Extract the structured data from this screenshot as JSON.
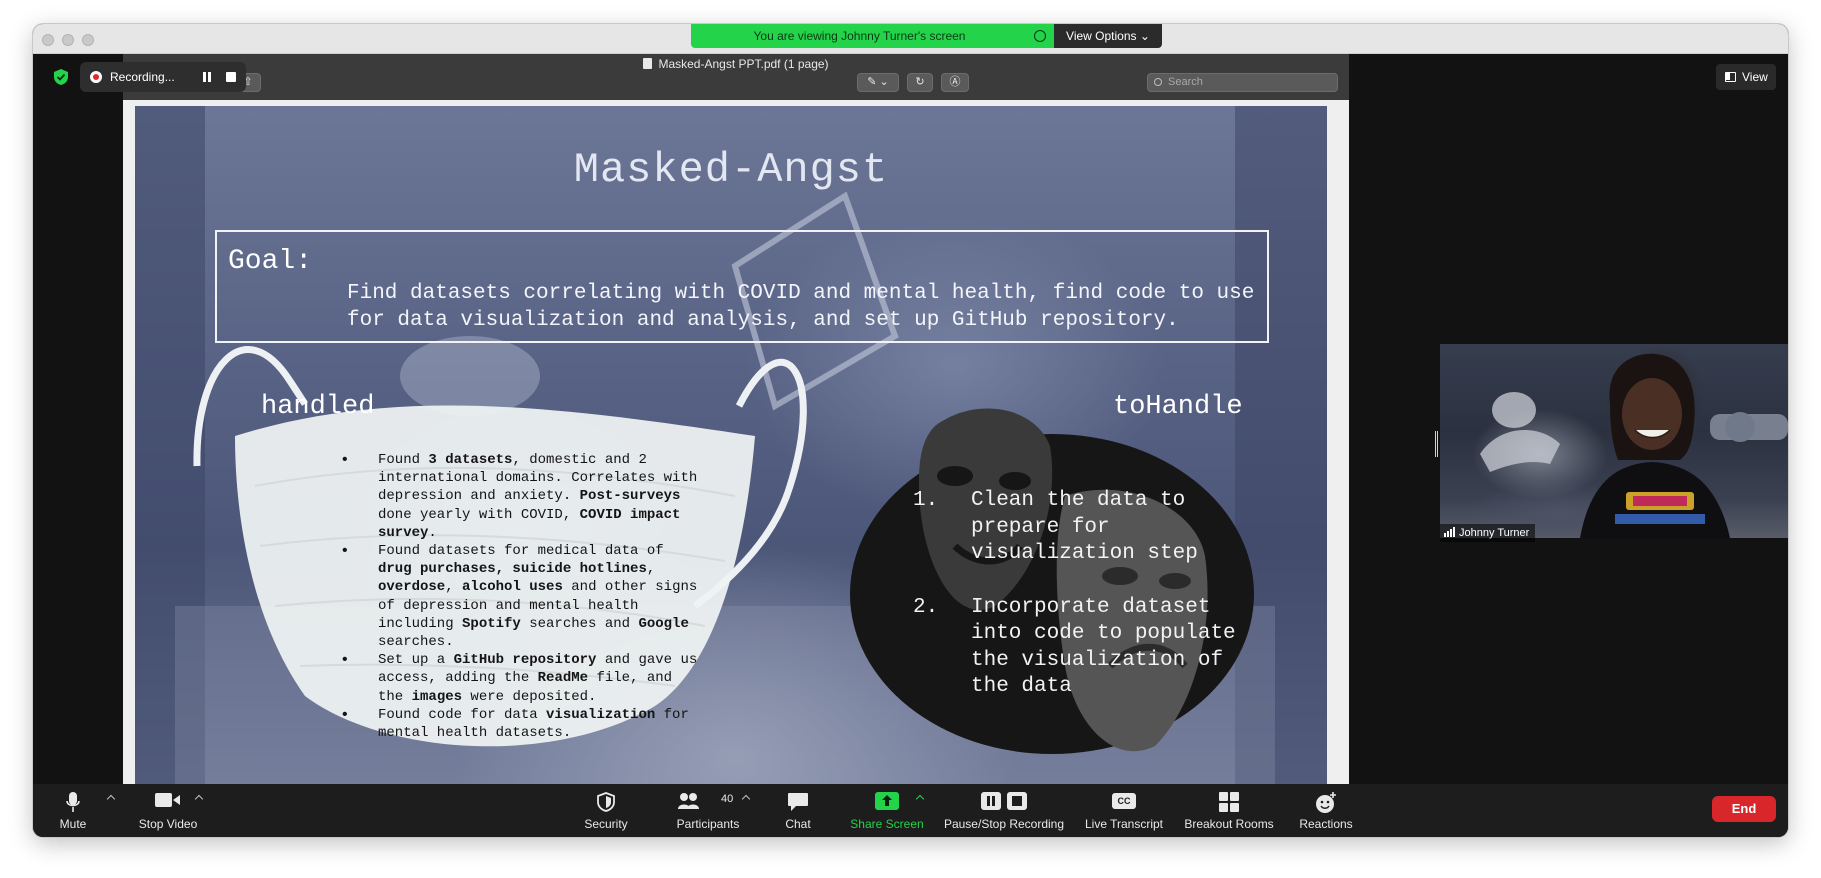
{
  "share_banner": {
    "text": "You are viewing Johnny Turner's screen",
    "view_options": "View Options"
  },
  "recording": {
    "label": "Recording..."
  },
  "view_button": {
    "label": "View"
  },
  "pdf": {
    "title": "Masked-Angst PPT.pdf (1 page)",
    "search_placeholder": "Search"
  },
  "slide": {
    "title": "Masked-Angst",
    "goal_label": "Goal:",
    "goal_text": "Find datasets correlating with COVID and mental health, find code to use for data visualization and analysis, and set up GitHub repository.",
    "handled_heading": "handled",
    "tohandle_heading": "toHandle",
    "handled_items": [
      {
        "segments": [
          {
            "text": "Found ",
            "bold": false
          },
          {
            "text": "3 datasets",
            "bold": true
          },
          {
            "text": ", domestic and 2 international domains. Correlates with depression and anxiety. ",
            "bold": false
          },
          {
            "text": "Post-surveys",
            "bold": true
          },
          {
            "text": " done yearly with COVID, ",
            "bold": false
          },
          {
            "text": "COVID impact survey",
            "bold": true
          },
          {
            "text": ".",
            "bold": false
          }
        ]
      },
      {
        "segments": [
          {
            "text": "Found datasets for medical data of ",
            "bold": false
          },
          {
            "text": "drug purchases, suicide hotlines",
            "bold": true
          },
          {
            "text": ", ",
            "bold": false
          },
          {
            "text": "overdose",
            "bold": true
          },
          {
            "text": ", ",
            "bold": false
          },
          {
            "text": "alcohol uses",
            "bold": true
          },
          {
            "text": " and other signs of depression and mental health including ",
            "bold": false
          },
          {
            "text": "Spotify",
            "bold": true
          },
          {
            "text": " searches and ",
            "bold": false
          },
          {
            "text": "Google",
            "bold": true
          },
          {
            "text": " searches.",
            "bold": false
          }
        ]
      },
      {
        "segments": [
          {
            "text": "Set up a ",
            "bold": false
          },
          {
            "text": "GitHub repository",
            "bold": true
          },
          {
            "text": " and gave us access, adding the ",
            "bold": false
          },
          {
            "text": "ReadMe",
            "bold": true
          },
          {
            "text": " file, and the ",
            "bold": false
          },
          {
            "text": "images",
            "bold": true
          },
          {
            "text": " were deposited.",
            "bold": false
          }
        ]
      },
      {
        "segments": [
          {
            "text": "Found code for data ",
            "bold": false
          },
          {
            "text": "visualization",
            "bold": true
          },
          {
            "text": " for mental health datasets.",
            "bold": false
          }
        ]
      }
    ],
    "tohandle_items": [
      {
        "num": "1.",
        "text": "Clean the data to prepare for visualization step"
      },
      {
        "num": "2.",
        "text": "Incorporate dataset into code to populate the visualization of the data"
      }
    ]
  },
  "participant": {
    "name": "Johnny Turner"
  },
  "controls": {
    "mute": "Mute",
    "stop_video": "Stop Video",
    "security": "Security",
    "participants": "Participants",
    "participants_count": "40",
    "chat": "Chat",
    "share_screen": "Share Screen",
    "pause_stop_recording": "Pause/Stop Recording",
    "live_transcript": "Live Transcript",
    "cc_label": "CC",
    "breakout_rooms": "Breakout Rooms",
    "reactions": "Reactions",
    "end": "End"
  },
  "icons": {
    "encryption": "shield-check-icon",
    "share_screen_color": "#23d34a",
    "end_color": "#d8262a",
    "recording_color": "#e5262c"
  }
}
